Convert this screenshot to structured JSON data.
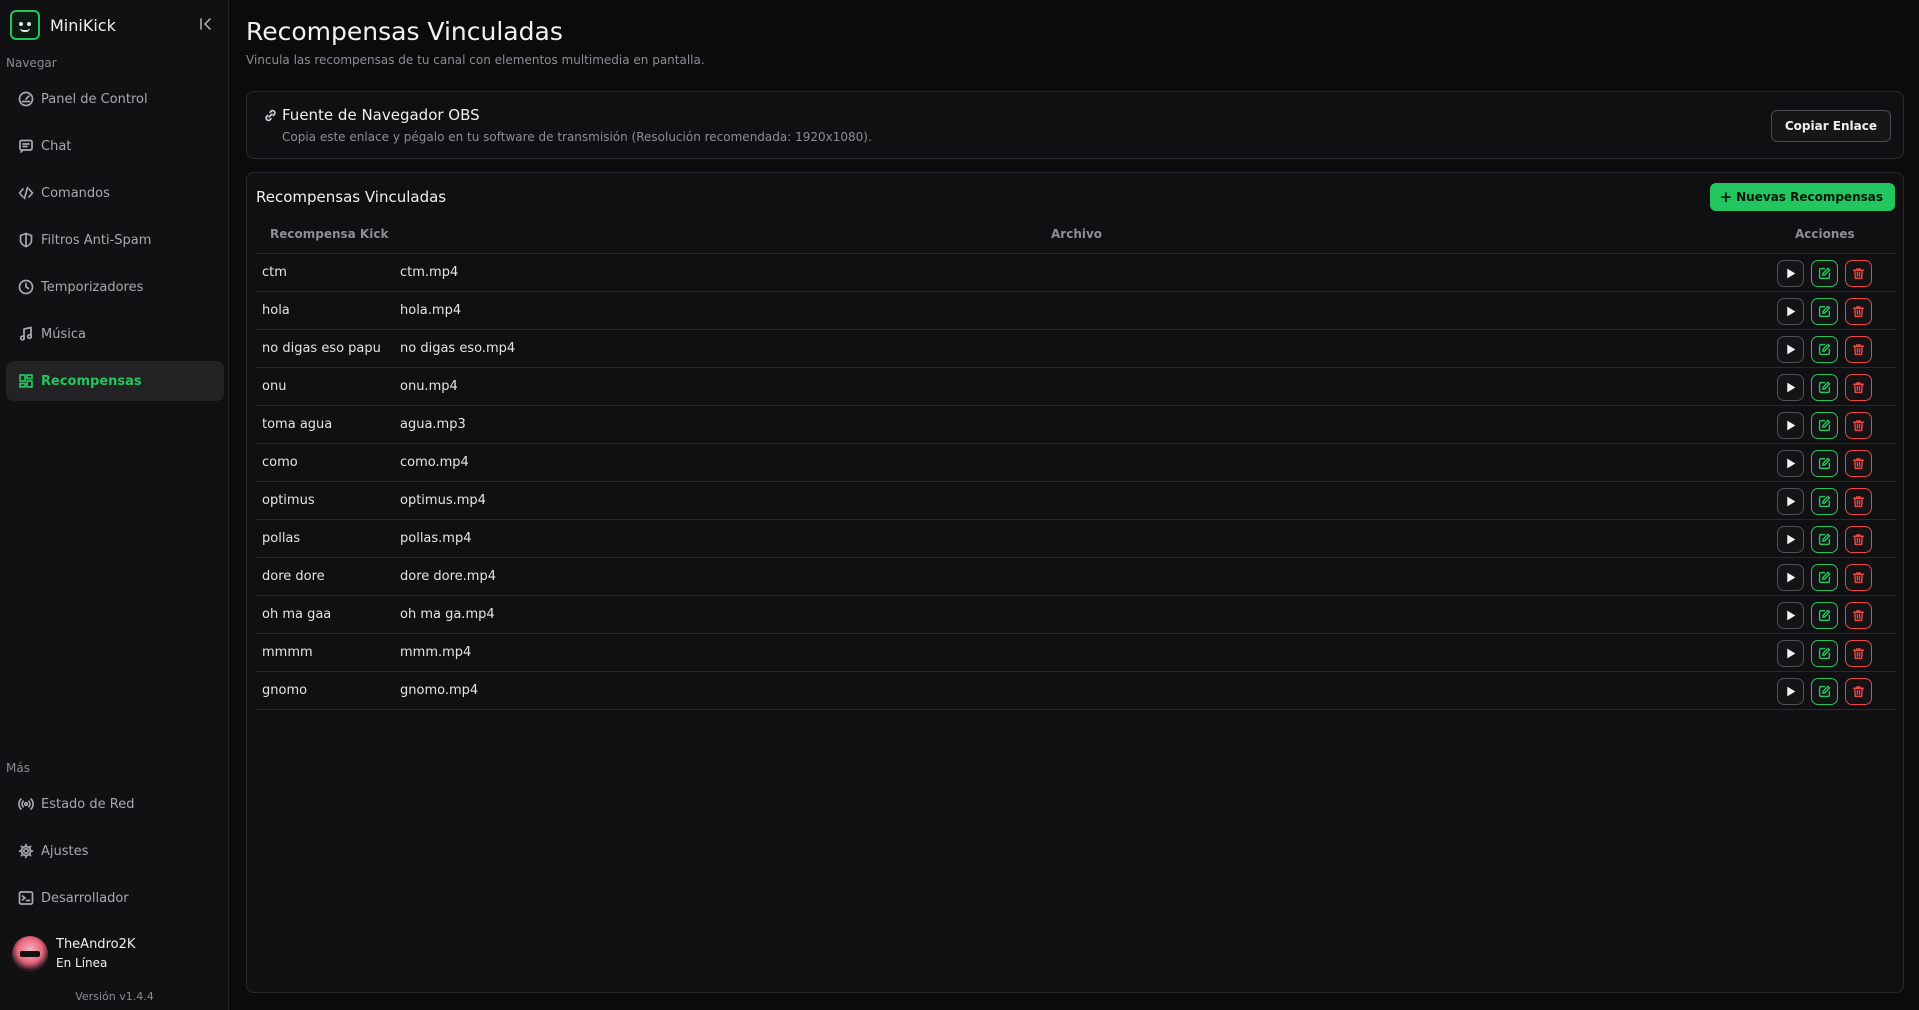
{
  "app": {
    "name": "MiniKick"
  },
  "sidebar": {
    "nav_label": "Navegar",
    "nav_items": [
      {
        "label": "Panel de Control",
        "icon": "dashboard-icon",
        "active": false
      },
      {
        "label": "Chat",
        "icon": "chat-icon",
        "active": false
      },
      {
        "label": "Comandos",
        "icon": "code-icon",
        "active": false
      },
      {
        "label": "Filtros Anti-Spam",
        "icon": "shield-icon",
        "active": false
      },
      {
        "label": "Temporizadores",
        "icon": "clock-icon",
        "active": false
      },
      {
        "label": "Música",
        "icon": "music-icon",
        "active": false
      },
      {
        "label": "Recompensas",
        "icon": "grid-icon",
        "active": true
      }
    ],
    "more_label": "Más",
    "more_items": [
      {
        "label": "Estado de Red",
        "icon": "broadcast-icon"
      },
      {
        "label": "Ajustes",
        "icon": "gear-icon"
      },
      {
        "label": "Desarrollador",
        "icon": "terminal-icon"
      }
    ],
    "user": {
      "name": "TheAndro2K",
      "status": "En Línea"
    },
    "version": "Versión v1.4.4"
  },
  "page": {
    "title": "Recompensas Vinculadas",
    "subtitle": "Vincula las recompensas de tu canal con elementos multimedia en pantalla."
  },
  "obs": {
    "title": "Fuente de Navegador OBS",
    "subtitle": "Copia este enlace y pégalo en tu software de transmisión (Resolución recomendada: 1920x1080).",
    "copy_label": "Copiar Enlace"
  },
  "rewards": {
    "title": "Recompensas Vinculadas",
    "new_label": "Nuevas Recompensas",
    "columns": {
      "reward": "Recompensa Kick",
      "file": "Archivo",
      "actions": "Acciones"
    },
    "rows": [
      {
        "reward": "ctm",
        "file": "ctm.mp4"
      },
      {
        "reward": "hola",
        "file": "hola.mp4"
      },
      {
        "reward": "no digas eso papu",
        "file": "no digas eso.mp4"
      },
      {
        "reward": "onu",
        "file": "onu.mp4"
      },
      {
        "reward": "toma agua",
        "file": "agua.mp3"
      },
      {
        "reward": "como",
        "file": "como.mp4"
      },
      {
        "reward": "optimus",
        "file": "optimus.mp4"
      },
      {
        "reward": "pollas",
        "file": "pollas.mp4"
      },
      {
        "reward": "dore dore",
        "file": "dore dore.mp4"
      },
      {
        "reward": "oh ma gaa",
        "file": "oh ma ga.mp4"
      },
      {
        "reward": "mmmm",
        "file": "mmm.mp4"
      },
      {
        "reward": "gnomo",
        "file": "gnomo.mp4"
      }
    ]
  },
  "colors": {
    "accent": "#22c55e",
    "danger": "#ef4444",
    "background": "#0b0b0c",
    "sidebar": "#111113"
  }
}
